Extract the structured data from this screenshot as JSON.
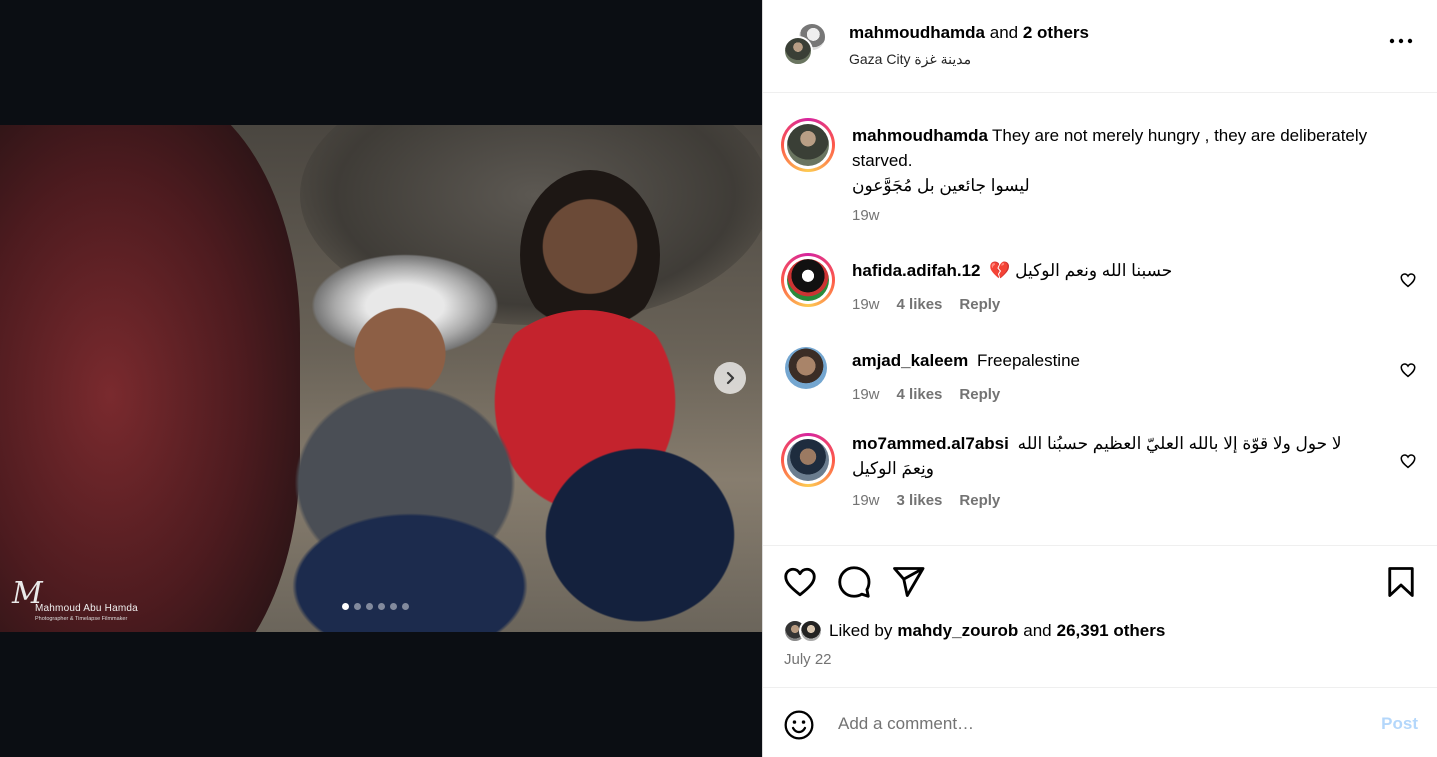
{
  "post": {
    "author": "mahmoudhamda",
    "and_text": "and",
    "others": "2 others",
    "location": "Gaza City مدينة غزة",
    "more_icon": "more-horizontal-icon"
  },
  "media": {
    "watermark_signature": "M",
    "watermark_name": "Mahmoud Abu Hamda",
    "watermark_role": "Photographer & Timelapse Filmmaker",
    "slide_count": 6,
    "active_slide": 1
  },
  "caption": {
    "username": "mahmoudhamda",
    "text": "They are not merely hungry , they are deliberately starved.",
    "text_ar": "ليسوا جائعين بل مُجَوَّعون",
    "time": "19w"
  },
  "comments": [
    {
      "username": "hafida.adifah.12",
      "text": "💔 حسبنا الله ونعم الوكيل",
      "time": "19w",
      "likes": "4 likes",
      "reply": "Reply"
    },
    {
      "username": "amjad_kaleem",
      "text": "Freepalestine",
      "time": "19w",
      "likes": "4 likes",
      "reply": "Reply"
    },
    {
      "username": "mo7ammed.al7absi",
      "text": "لا حول ولا قوّة إلا بالله العليّ العظيم حسبُنا الله ونِعمَ الوكيل",
      "time": "19w",
      "likes": "3 likes",
      "reply": "Reply"
    }
  ],
  "actions": {
    "liked_by_prefix": "Liked by",
    "liked_by_user": "mahdy_zourob",
    "and_text": "and",
    "others_count": "26,391 others",
    "date": "July 22"
  },
  "add_comment": {
    "placeholder": "Add a comment…",
    "post_label": "Post"
  },
  "colors": {
    "media_bg": "#0b0e13",
    "post_disabled": "#b4d7fb",
    "meta_text": "#737373",
    "divider": "#efefef"
  }
}
